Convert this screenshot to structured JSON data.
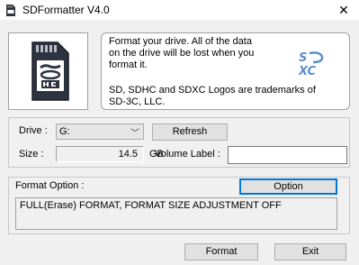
{
  "window": {
    "title": "SDFormatter V4.0",
    "close_glyph": "✕",
    "app_icon": "sd-card-icon"
  },
  "info": {
    "line1": "Format your drive. All of the data",
    "line2": "on the drive will be lost when you",
    "line3": "format it.",
    "line4": "SD, SDHC and SDXC Logos are trademarks of",
    "line5": "SD-3C, LLC.",
    "logo_card": "sdhc-card-icon",
    "logo_right": "sdxc-logo"
  },
  "drive": {
    "label": "Drive :",
    "value": "G:",
    "chevron": "﹀",
    "refresh_label": "Refresh",
    "size_label": "Size :",
    "size_value": "14.5",
    "size_unit": "GB",
    "volume_label": "Volume Label :",
    "volume_value": ""
  },
  "format_option": {
    "label": "Format Option :",
    "option_button": "Option",
    "current": "FULL(Erase) FORMAT, FORMAT SIZE ADJUSTMENT OFF"
  },
  "actions": {
    "format_label": "Format",
    "exit_label": "Exit"
  },
  "colors": {
    "accent": "#0078d7",
    "card_body": "#2d3340",
    "logo_blue": "#5b8fc8"
  }
}
